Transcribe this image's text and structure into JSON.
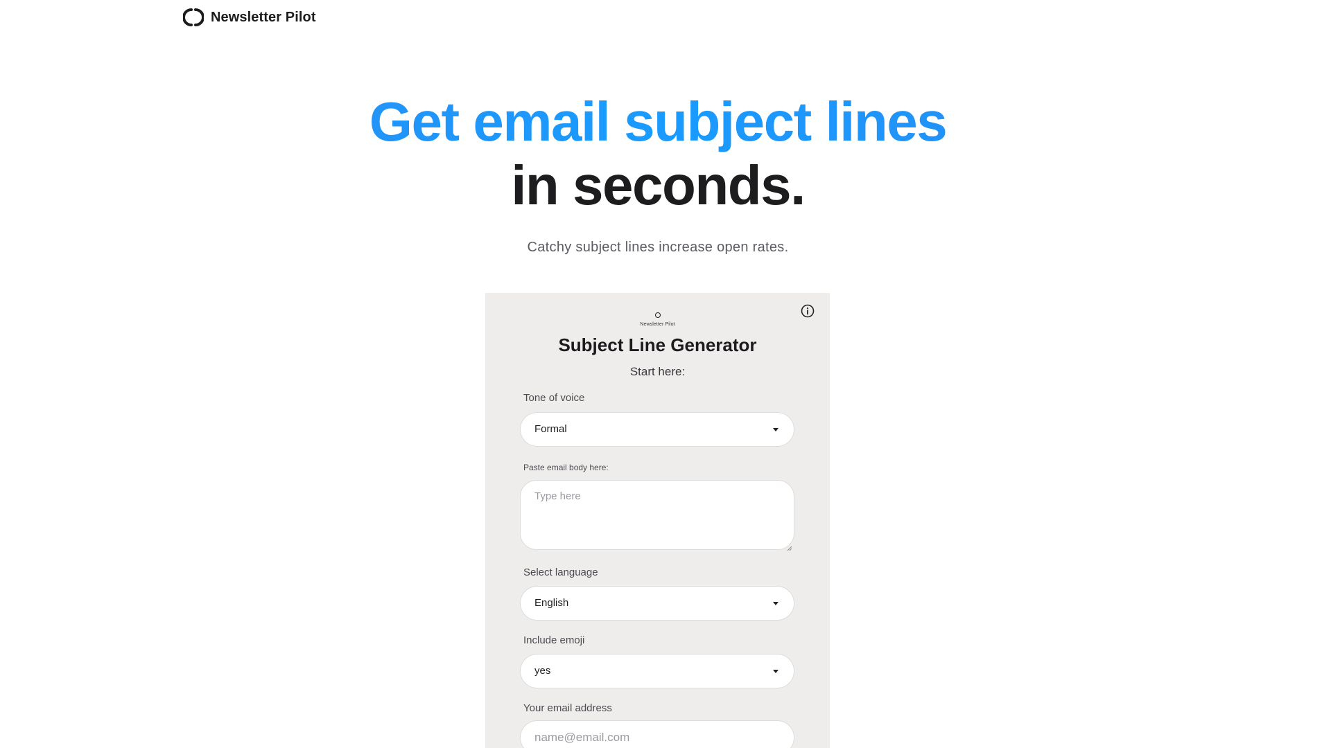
{
  "header": {
    "brand_name": "Newsletter Pilot",
    "logo_icon": "brand-ring-icon"
  },
  "hero": {
    "line1": "Get email subject lines",
    "line2": "in seconds.",
    "subtitle": "Catchy subject lines increase open rates.",
    "accent_color": "#1e8ff5"
  },
  "card": {
    "mini_logo_text": "Newsletter Pilot",
    "title": "Subject Line Generator",
    "start_text": "Start here:",
    "info_icon": "info-icon",
    "background": "#efedeb",
    "fields": {
      "tone": {
        "label": "Tone of voice",
        "value": "Formal"
      },
      "body": {
        "label": "Paste email body here:",
        "placeholder": "Type here"
      },
      "language": {
        "label": "Select language",
        "value": "English"
      },
      "emoji": {
        "label": "Include emoji",
        "value": "yes"
      },
      "email": {
        "label": "Your email address",
        "placeholder": "name@email.com"
      }
    }
  }
}
